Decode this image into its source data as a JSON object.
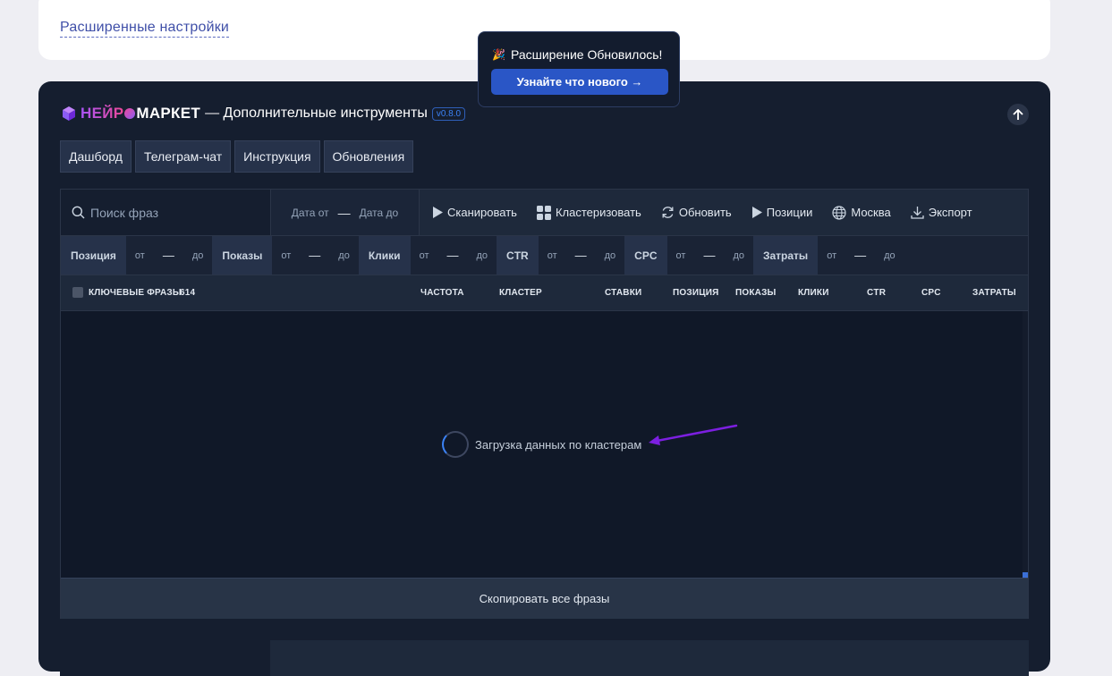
{
  "top_card": {
    "advanced_settings_link": "Расширенные настройки"
  },
  "header": {
    "logo_part1": "НЕЙР",
    "logo_part2": "МАРКЕТ",
    "subtitle": "— Дополнительные инструменты",
    "version": "v0.8.0",
    "up_icon": "arrow-up-icon"
  },
  "tabs": [
    {
      "label": "Дашборд"
    },
    {
      "label": "Телеграм-чат"
    },
    {
      "label": "Инструкция"
    },
    {
      "label": "Обновления"
    }
  ],
  "toolbar": {
    "search_placeholder": "Поиск фраз",
    "date_from": "Дата от",
    "date_dash": "—",
    "date_to": "Дата до",
    "scan_label": "Сканировать",
    "cluster_label": "Кластеризовать",
    "refresh_label": "Обновить",
    "positions_label": "Позиции",
    "region_label": "Москва",
    "export_label": "Экспорт"
  },
  "filters": [
    {
      "label": "Позиция",
      "from": "от",
      "dash": "—",
      "to": "до"
    },
    {
      "label": "Показы",
      "from": "от",
      "dash": "—",
      "to": "до"
    },
    {
      "label": "Клики",
      "from": "от",
      "dash": "—",
      "to": "до"
    },
    {
      "label": "CTR",
      "from": "от",
      "dash": "—",
      "to": "до"
    },
    {
      "label": "CPC",
      "from": "от",
      "dash": "—",
      "to": "до"
    },
    {
      "label": "Затраты",
      "from": "от",
      "dash": "—",
      "to": "до"
    }
  ],
  "columns": {
    "keywords": "КЛЮЧЕВЫЕ ФРАЗЫ",
    "keywords_count": "614",
    "frequency": "ЧАСТОТА",
    "cluster": "КЛАСТЕР",
    "bids": "СТАВКИ",
    "position": "ПОЗИЦИЯ",
    "impressions": "ПОКАЗЫ",
    "clicks": "КЛИКИ",
    "ctr": "CTR",
    "cpc": "CPC",
    "costs": "ЗАТРАТЫ"
  },
  "loading_text": "Загрузка данных по кластерам",
  "copy_all_label": "Скопировать все фразы",
  "toast": {
    "emoji": "🎉",
    "title": "Расширение Обновилось!",
    "button_label": "Узнайте что нового →"
  },
  "colors": {
    "accent_blue": "#2a56c6",
    "panel_bg": "#151e2f",
    "arrow_purple": "#7c1fe0"
  }
}
